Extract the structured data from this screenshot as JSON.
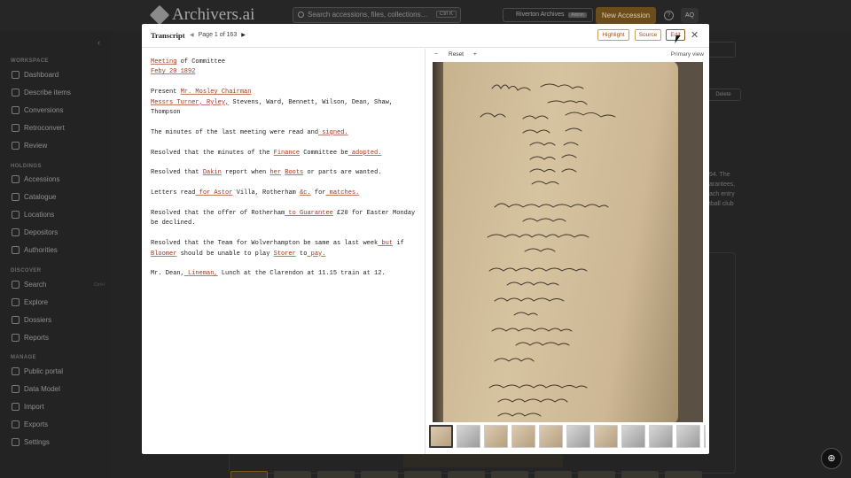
{
  "app": {
    "logo": "Archivers.ai",
    "search_placeholder": "Search accessions, files, collections…",
    "search_shortcut": "Ctrl K",
    "archive_name": "Riverton Archives",
    "archive_tag": "Admin",
    "new_accession_label": "New Accession",
    "help_label": "?",
    "user_initials": "AQ"
  },
  "sidebar": {
    "collapse_label": "‹",
    "sections": [
      {
        "title": "WORKSPACE",
        "items": [
          {
            "label": "Dashboard"
          },
          {
            "label": "Describe items"
          },
          {
            "label": "Conversions"
          },
          {
            "label": "Retroconvert"
          },
          {
            "label": "Review"
          }
        ]
      },
      {
        "title": "HOLDINGS",
        "items": [
          {
            "label": "Accessions"
          },
          {
            "label": "Catalogue"
          },
          {
            "label": "Locations"
          },
          {
            "label": "Depositors"
          },
          {
            "label": "Authorities"
          }
        ]
      },
      {
        "title": "DISCOVER",
        "items": [
          {
            "label": "Search",
            "hint": "Ctrl+/"
          },
          {
            "label": "Explore"
          },
          {
            "label": "Dossiers"
          },
          {
            "label": "Reports"
          }
        ]
      },
      {
        "title": "MANAGE",
        "items": [
          {
            "label": "Public portal"
          },
          {
            "label": "Data Model"
          },
          {
            "label": "Import"
          },
          {
            "label": "Exports"
          },
          {
            "label": "Settings"
          }
        ]
      }
    ]
  },
  "background": {
    "delete_label": "Delete",
    "text_lines": [
      "94. The",
      "arantees,",
      "ach entry",
      "tball club"
    ]
  },
  "modal": {
    "title": "Transcript",
    "page_indicator": "Page 1 of 163",
    "prev_label": "◀",
    "next_label": "▶",
    "highlight_label": "Highlight",
    "source_label": "Source",
    "edit_label": "Edit",
    "close_label": "✕"
  },
  "transcript": {
    "p1": {
      "a": "Meeting",
      "b": " of Committee"
    },
    "p1b": {
      "a": "Feby 20 1892"
    },
    "p2": {
      "a": "Present ",
      "b": "Mr. Mosley Chairman"
    },
    "p2b": {
      "a": "Messrs Turner, Ryley,",
      "b": " Stevens, Ward, Bennett, Wilson, Dean, Shaw,"
    },
    "p2c": "Thompson",
    "p3": {
      "a": "The minutes of the last meeting were read and",
      "b": " signed."
    },
    "p4": {
      "a": "Resolved that the minutes of the ",
      "b": "Finance",
      "c": " Committee be",
      "d": " adopted."
    },
    "p5": {
      "a": "Resolved that ",
      "b": "Dakin",
      "c": " report when ",
      "d": "her",
      "e": " ",
      "f": "Boots",
      "g": " or parts are wanted."
    },
    "p6": {
      "a": "Letters read",
      "b": " for Astor",
      "c": " Villa, Rotherham ",
      "d": "&c.",
      "e": " for",
      "f": " matches."
    },
    "p7": {
      "a": "Resolved that the offer of Rotherham",
      "b": " to Guarantee",
      "c": " £20 for Easter Monday"
    },
    "p7b": "be declined.",
    "p8": {
      "a": "Resolved that the Team for Wolverhampton be same as last week",
      "b": " but",
      "c": " if"
    },
    "p8b": {
      "a": "Bloomer",
      "b": " should be unable to play ",
      "c": "Storer",
      "d": " to",
      "e": " pay."
    },
    "p9": {
      "a": "Mr. Dean,",
      "b": " Lineman,",
      "c": " Lunch at the Clarendon at 11.15 train at 12."
    }
  },
  "viewer": {
    "zoom_out_label": "−",
    "reset_label": "Reset",
    "zoom_in_label": "+",
    "view_label": "Primary view",
    "thumbnail_count": 11,
    "active_thumbnail": 1
  },
  "fab_label": "⊕"
}
